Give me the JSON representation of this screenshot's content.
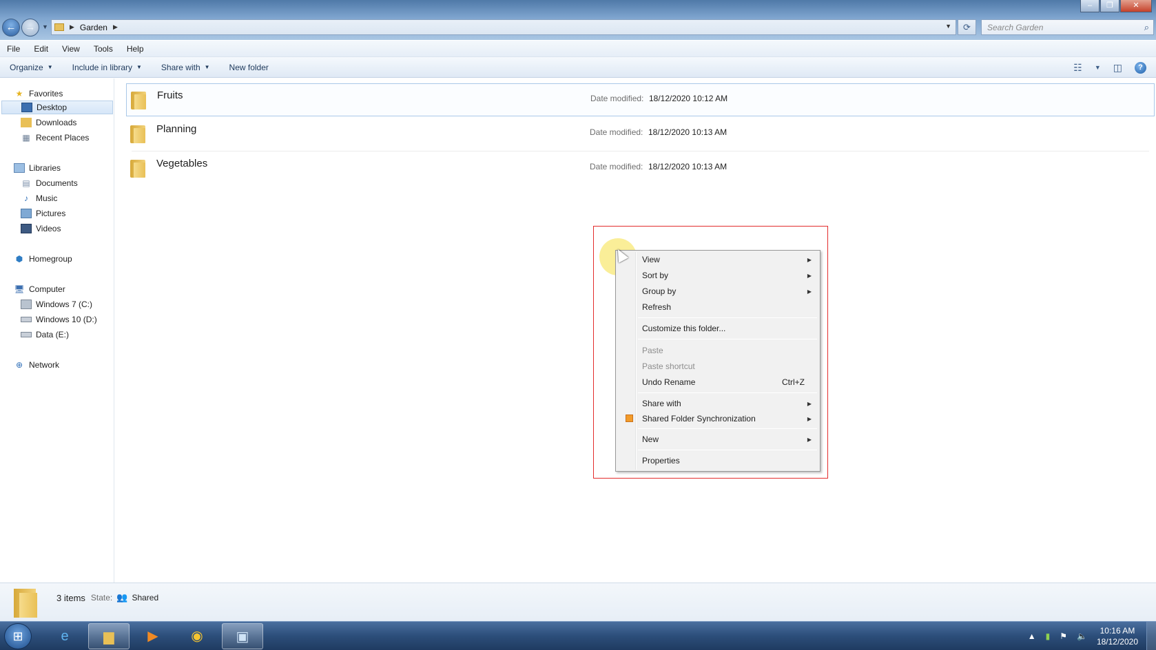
{
  "window": {
    "controls": [
      "–",
      "❐",
      "✕"
    ]
  },
  "address_bar": {
    "breadcrumb": [
      "Garden"
    ],
    "search_placeholder": "Search Garden"
  },
  "menu": [
    "File",
    "Edit",
    "View",
    "Tools",
    "Help"
  ],
  "command_bar": {
    "organize": "Organize",
    "include_in_library": "Include in library",
    "share_with": "Share with",
    "new_folder": "New folder"
  },
  "nav": {
    "favorites": "Favorites",
    "desktop": "Desktop",
    "downloads": "Downloads",
    "recent_places": "Recent Places",
    "libraries": "Libraries",
    "documents": "Documents",
    "music": "Music",
    "pictures": "Pictures",
    "videos": "Videos",
    "homegroup": "Homegroup",
    "computer": "Computer",
    "drive_c": "Windows 7 (C:)",
    "drive_d": "Windows 10 (D:)",
    "drive_e": "Data (E:)",
    "network": "Network"
  },
  "files": [
    {
      "name": "Fruits",
      "date_label": "Date modified:",
      "date": "18/12/2020 10:12 AM"
    },
    {
      "name": "Planning",
      "date_label": "Date modified:",
      "date": "18/12/2020 10:13 AM"
    },
    {
      "name": "Vegetables",
      "date_label": "Date modified:",
      "date": "18/12/2020 10:13 AM"
    }
  ],
  "context_menu": {
    "view": "View",
    "sort_by": "Sort by",
    "group_by": "Group by",
    "refresh": "Refresh",
    "customize": "Customize this folder...",
    "paste": "Paste",
    "paste_shortcut": "Paste shortcut",
    "undo_rename": "Undo Rename",
    "undo_shortcut": "Ctrl+Z",
    "share_with": "Share with",
    "shared_folder_sync": "Shared Folder Synchronization",
    "new": "New",
    "properties": "Properties"
  },
  "details": {
    "count": "3 items",
    "state_label": "State:",
    "state_value": "Shared"
  },
  "taskbar": {
    "time": "10:16 AM",
    "date": "18/12/2020"
  },
  "colors": {
    "highlight_box": "#e32b2b",
    "selection": "#a9c8e8",
    "cursor_halo": "#f8e876"
  }
}
